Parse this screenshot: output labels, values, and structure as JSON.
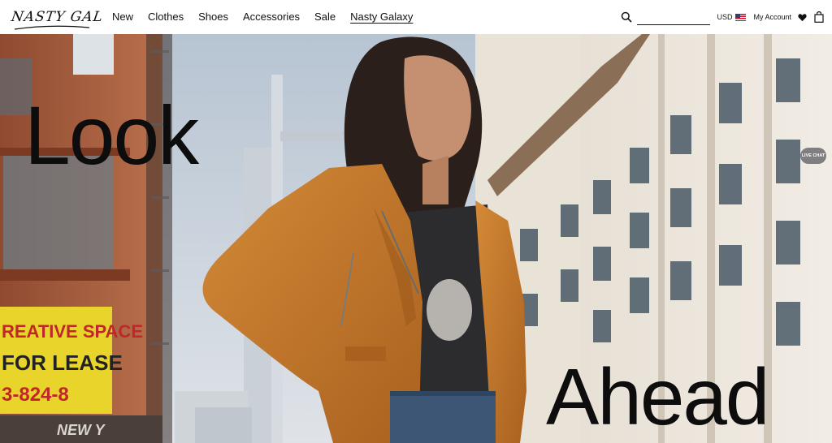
{
  "header": {
    "logo_text": "NASTY GAL",
    "nav": [
      {
        "label": "New"
      },
      {
        "label": "Clothes"
      },
      {
        "label": "Shoes"
      },
      {
        "label": "Accessories"
      },
      {
        "label": "Sale"
      },
      {
        "label": "Nasty Galaxy"
      }
    ],
    "search": {
      "placeholder": "",
      "value": ""
    },
    "currency": "USD",
    "account_label": "My Account",
    "icons": [
      "search-icon",
      "us-flag-icon",
      "heart-icon",
      "shopping-bag-icon"
    ]
  },
  "hero": {
    "headline_top": "Look",
    "headline_bottom": "Ahead",
    "live_chat_label": "LIVE CHAT",
    "sign_lines": [
      "REATIVE SPACE",
      "FOR LEASE",
      "3-824-8"
    ],
    "sign_neon": "NEW Y"
  },
  "colors": {
    "jacket": "#c77a2b",
    "brick": "#a85a3a",
    "sky": "#b9c6d3",
    "sign_yellow": "#e8d42a",
    "text": "#0d0d0d"
  }
}
